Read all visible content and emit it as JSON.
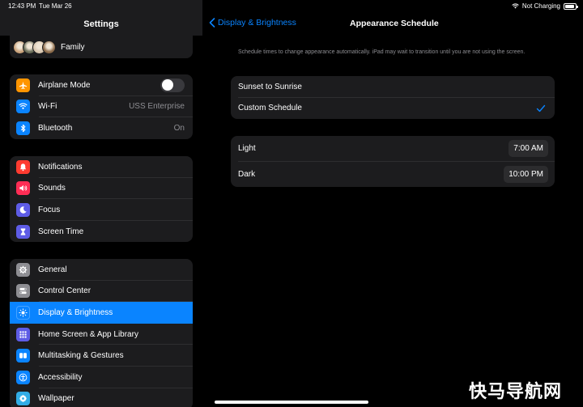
{
  "status_bar": {
    "time": "12:43 PM",
    "date": "Tue Mar 26",
    "charging": "Not Charging",
    "battery_level_pct": 90
  },
  "sidebar": {
    "title": "Settings",
    "family_label": "Family",
    "avatar_colors": [
      "#c9a27a",
      "#6b6f5a",
      "#d9c7b0",
      "#8a6a4a"
    ],
    "group1": [
      {
        "label": "Airplane Mode",
        "icon": "airplane-icon",
        "color": "#ff9500",
        "toggle": false
      },
      {
        "label": "Wi-Fi",
        "icon": "wifi-icon",
        "color": "#0a84ff",
        "value": "USS Enterprise"
      },
      {
        "label": "Bluetooth",
        "icon": "bluetooth-icon",
        "color": "#0a84ff",
        "value": "On"
      }
    ],
    "group2": [
      {
        "label": "Notifications",
        "icon": "bell-icon",
        "color": "#ff3b30"
      },
      {
        "label": "Sounds",
        "icon": "speaker-icon",
        "color": "#ff2d55"
      },
      {
        "label": "Focus",
        "icon": "moon-icon",
        "color": "#5e5ce6"
      },
      {
        "label": "Screen Time",
        "icon": "hourglass-icon",
        "color": "#5e5ce6"
      }
    ],
    "group3": [
      {
        "label": "General",
        "icon": "gear-icon",
        "color": "#8e8e93"
      },
      {
        "label": "Control Center",
        "icon": "switches-icon",
        "color": "#8e8e93"
      },
      {
        "label": "Display & Brightness",
        "icon": "sun-icon",
        "color": "#0a84ff",
        "selected": true
      },
      {
        "label": "Home Screen & App Library",
        "icon": "grid-icon",
        "color": "#5e5ce6"
      },
      {
        "label": "Multitasking & Gestures",
        "icon": "multitask-icon",
        "color": "#0a84ff"
      },
      {
        "label": "Accessibility",
        "icon": "accessibility-icon",
        "color": "#0a84ff"
      },
      {
        "label": "Wallpaper",
        "icon": "flower-icon",
        "color": "#32ade6"
      }
    ]
  },
  "detail": {
    "back_label": "Display & Brightness",
    "title": "Appearance Schedule",
    "description": "Schedule times to change appearance automatically. iPad may wait to transition until you are not using the screen.",
    "schedule_options": [
      {
        "label": "Sunset to Sunrise",
        "checked": false
      },
      {
        "label": "Custom Schedule",
        "checked": true
      }
    ],
    "times": [
      {
        "label": "Light",
        "value": "7:00 AM"
      },
      {
        "label": "Dark",
        "value": "10:00 PM"
      }
    ]
  },
  "watermark": "快马导航网",
  "accent_color": "#0a84ff"
}
